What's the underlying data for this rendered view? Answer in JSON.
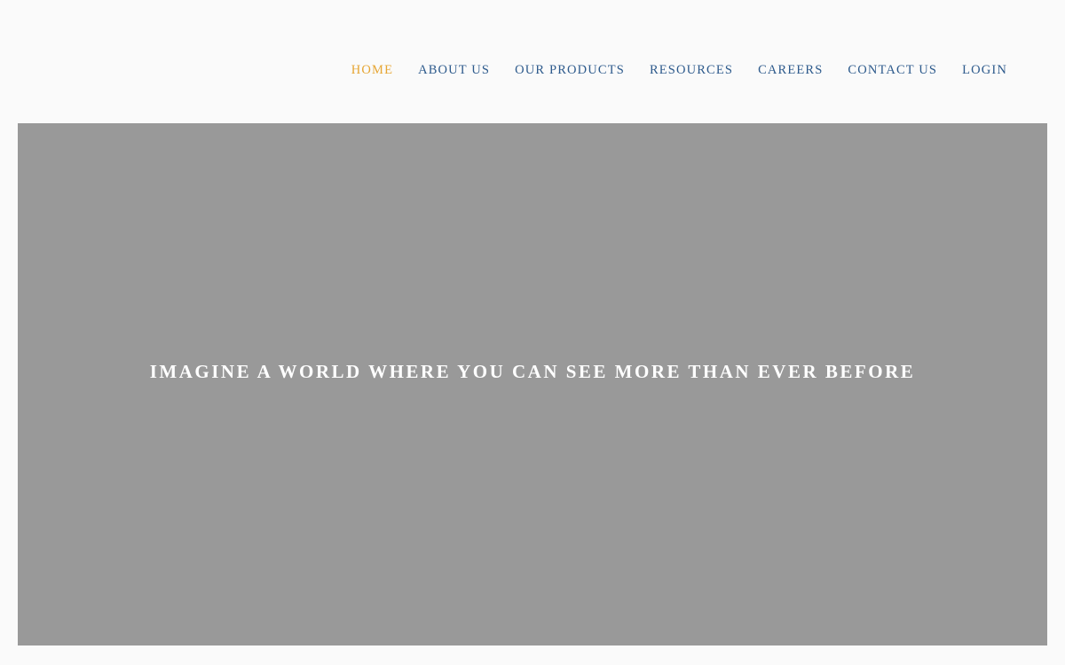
{
  "nav": {
    "items": [
      {
        "label": "HOME",
        "active": true
      },
      {
        "label": "ABOUT US",
        "active": false
      },
      {
        "label": "OUR PRODUCTS",
        "active": false
      },
      {
        "label": "RESOURCES",
        "active": false
      },
      {
        "label": "CAREERS",
        "active": false
      },
      {
        "label": "CONTACT US",
        "active": false
      },
      {
        "label": "LOGIN",
        "active": false
      }
    ]
  },
  "hero": {
    "title": "IMAGINE A WORLD WHERE YOU CAN SEE MORE THAN EVER BEFORE"
  },
  "colors": {
    "page_background": "#fafafa",
    "nav_active": "#e6a532",
    "nav_link": "#2d5a8c",
    "hero_background": "#999999",
    "hero_text": "#ffffff"
  }
}
